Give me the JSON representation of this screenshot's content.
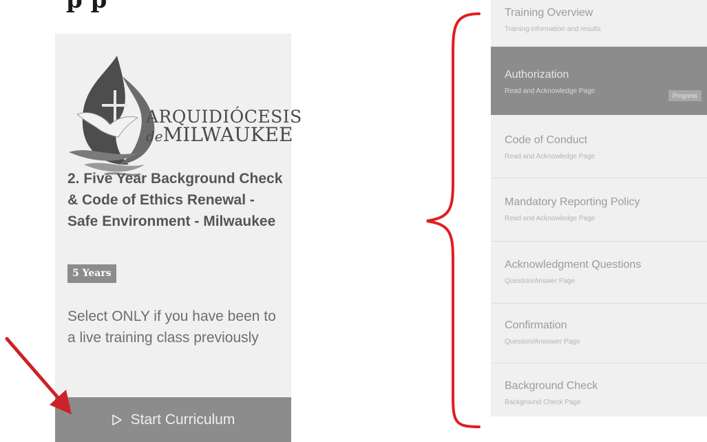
{
  "header": {
    "heading": "p p"
  },
  "card": {
    "logo": {
      "line1": "ARQUIDIÓCESIS",
      "line2_prefix": "de",
      "line2_main": "MILWAUKEE",
      "icon": "dove-cross-flame-logo"
    },
    "title": "2. Five Year Background Check & Code of Ethics Renewal - Safe Environment - Milwaukee",
    "duration_badge": "5 Years",
    "note": "Select ONLY if you have been to a live training class previously",
    "start_button": {
      "label": "Start Curriculum",
      "icon": "play-outline-icon"
    }
  },
  "steps": [
    {
      "title": "Training Overview",
      "subtitle": "Training information and results",
      "active": false
    },
    {
      "title": "Authorization",
      "subtitle": "Read and Acknowledge Page",
      "active": true,
      "badge": "Progress"
    },
    {
      "title": "Code of Conduct",
      "subtitle": "Read and Acknowledge Page",
      "active": false
    },
    {
      "title": "Mandatory Reporting Policy",
      "subtitle": "Read and Acknowledge Page",
      "active": false
    },
    {
      "title": "Acknowledgment Questions",
      "subtitle": "Question/Answer Page",
      "active": false
    },
    {
      "title": "Confirmation",
      "subtitle": "Question/Anwswer Page",
      "active": false
    },
    {
      "title": "Background Check",
      "subtitle": "Background Check Page",
      "active": false
    }
  ],
  "annotations": {
    "arrow_color": "#cc2229",
    "brace_color": "#e01f1f"
  },
  "colors": {
    "card_bg": "#f0f0f0",
    "button_bg": "#8c8c8c",
    "active_step_bg": "#8c8c8c"
  }
}
